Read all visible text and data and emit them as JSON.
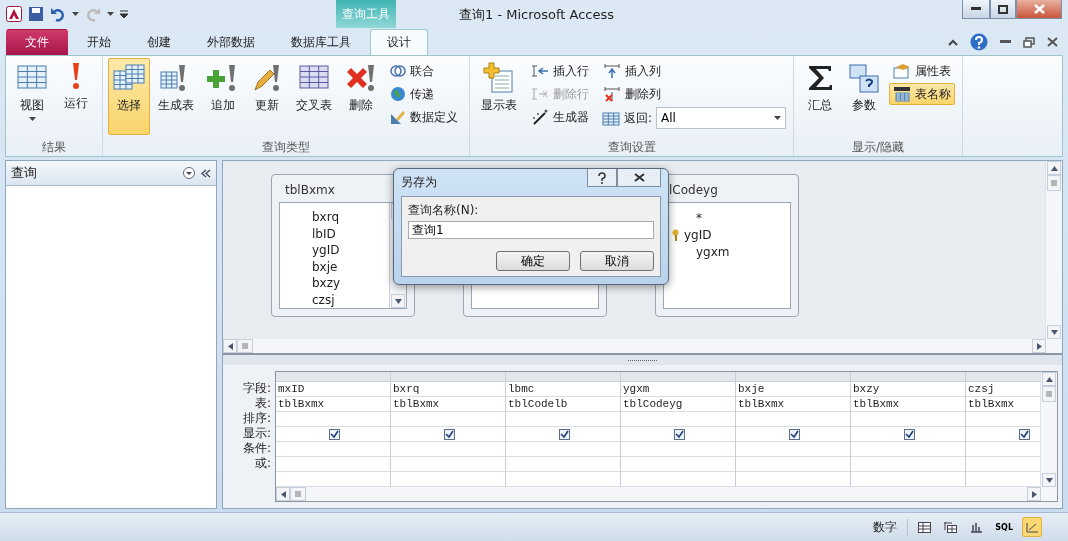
{
  "window": {
    "title": "查询1  -  Microsoft Access",
    "contextual_tab": "查询工具"
  },
  "ribbon_tabs": [
    {
      "label": "文件",
      "kind": "file",
      "selected": false
    },
    {
      "label": "开始",
      "kind": "tab",
      "selected": false
    },
    {
      "label": "创建",
      "kind": "tab",
      "selected": false
    },
    {
      "label": "外部数据",
      "kind": "tab",
      "selected": false
    },
    {
      "label": "数据库工具",
      "kind": "tab",
      "selected": false
    },
    {
      "label": "设计",
      "kind": "tab",
      "selected": true
    }
  ],
  "ribbon_groups": [
    {
      "label": "结果",
      "buttons": [
        {
          "label": "视图",
          "kind": "large-menu",
          "selected": false
        },
        {
          "label": "运行",
          "kind": "large",
          "selected": false
        }
      ]
    },
    {
      "label": "查询类型",
      "buttons": [
        {
          "label": "选择",
          "kind": "large",
          "selected": true
        },
        {
          "label": "生成表",
          "kind": "large",
          "selected": false
        },
        {
          "label": "追加",
          "kind": "large",
          "selected": false
        },
        {
          "label": "更新",
          "kind": "large",
          "selected": false
        },
        {
          "label": "交叉表",
          "kind": "large",
          "selected": false
        },
        {
          "label": "删除",
          "kind": "large",
          "selected": false
        },
        {
          "label": "联合",
          "kind": "small",
          "selected": false
        },
        {
          "label": "传递",
          "kind": "small",
          "selected": false
        },
        {
          "label": "数据定义",
          "kind": "small",
          "selected": false
        }
      ]
    },
    {
      "label": "查询设置",
      "buttons": [
        {
          "label": "显示表",
          "kind": "large",
          "selected": false
        },
        {
          "label": "插入行",
          "kind": "small",
          "selected": false,
          "disabled": false
        },
        {
          "label": "删除行",
          "kind": "small",
          "selected": false,
          "disabled": true
        },
        {
          "label": "生成器",
          "kind": "small",
          "selected": false,
          "disabled": false
        },
        {
          "label": "插入列",
          "kind": "small",
          "selected": false,
          "disabled": false
        },
        {
          "label": "删除列",
          "kind": "small",
          "selected": false,
          "disabled": false
        },
        {
          "label": "返回:",
          "kind": "combo",
          "value": "All"
        }
      ]
    },
    {
      "label": "显示/隐藏",
      "buttons": [
        {
          "label": "汇总",
          "kind": "large",
          "selected": false
        },
        {
          "label": "参数",
          "kind": "large",
          "selected": false
        },
        {
          "label": "属性表",
          "kind": "small",
          "selected": false
        },
        {
          "label": "表名称",
          "kind": "small",
          "selected": true
        }
      ]
    }
  ],
  "nav_pane": {
    "title": "查询"
  },
  "tables": [
    {
      "name": "tblBxmx",
      "scroll": true,
      "fields": [
        {
          "name": "bxrq",
          "key": false
        },
        {
          "name": "lbID",
          "key": false
        },
        {
          "name": "ygID",
          "key": false
        },
        {
          "name": "bxje",
          "key": false
        },
        {
          "name": "bxzy",
          "key": false
        },
        {
          "name": "czsj",
          "key": false
        }
      ]
    },
    {
      "scroll": false
    },
    {
      "name": "lCodeyg",
      "scroll": false,
      "fields": [
        {
          "name": "*",
          "key": false
        },
        {
          "name": "ygID",
          "key": true
        },
        {
          "name": "ygxm",
          "key": false
        }
      ]
    }
  ],
  "grid": {
    "row_labels": [
      "字段:",
      "表:",
      "排序:",
      "显示:",
      "条件:",
      "或:"
    ],
    "columns": [
      {
        "field": "mxID",
        "table": "tblBxmx",
        "show": true
      },
      {
        "field": "bxrq",
        "table": "tblBxmx",
        "show": true
      },
      {
        "field": "lbmc",
        "table": "tblCodelb",
        "show": true
      },
      {
        "field": "ygxm",
        "table": "tblCodeyg",
        "show": true
      },
      {
        "field": "bxje",
        "table": "tblBxmx",
        "show": true
      },
      {
        "field": "bxzy",
        "table": "tblBxmx",
        "show": true
      },
      {
        "field": "czsj",
        "table": "tblBxmx",
        "show": true
      }
    ]
  },
  "dialog": {
    "title": "另存为",
    "label": "查询名称(N):",
    "value": "查询1",
    "buttons": [
      "确定",
      "取消"
    ]
  },
  "status_bar": {
    "text": "数字",
    "views": [
      {
        "kind": "datasheet",
        "selected": false
      },
      {
        "kind": "pivot-table",
        "selected": false
      },
      {
        "kind": "pivot-chart",
        "selected": false
      },
      {
        "kind": "sql",
        "label": "SQL",
        "selected": false
      },
      {
        "kind": "design",
        "selected": true
      }
    ]
  }
}
